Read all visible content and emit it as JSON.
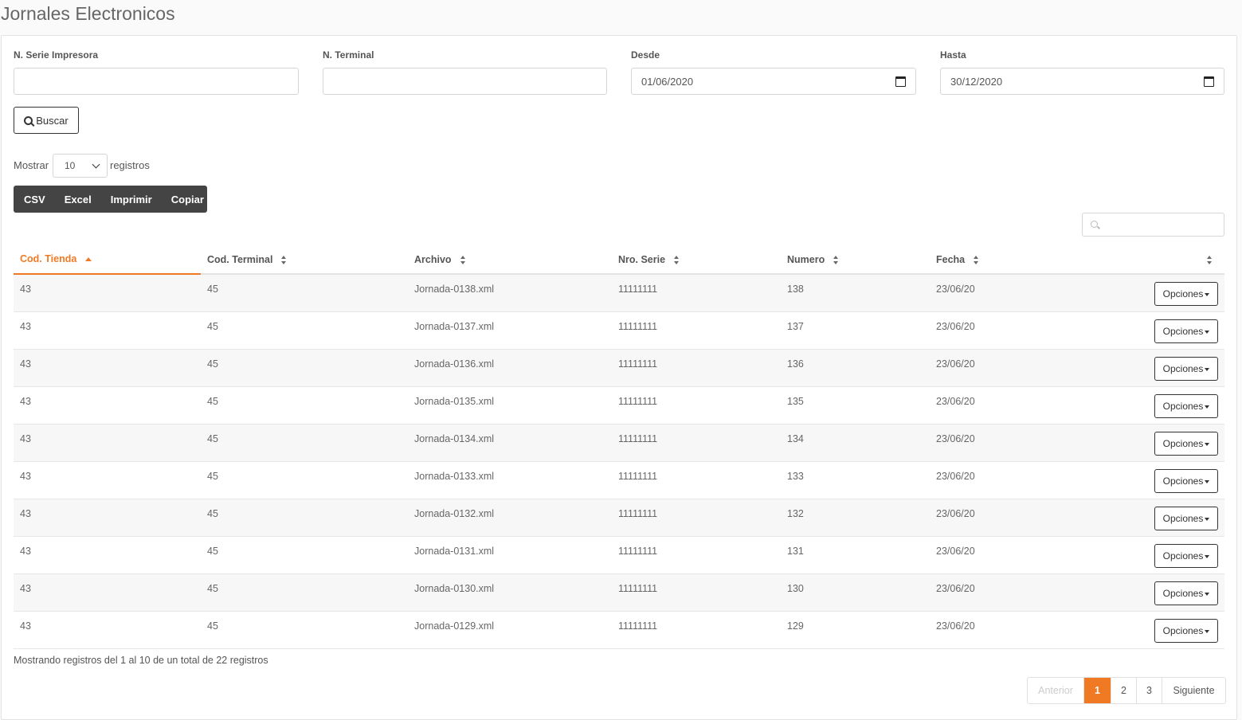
{
  "page_title": "Jornales Electronicos",
  "filters": {
    "serie_label": "N. Serie Impresora",
    "serie_value": "",
    "terminal_label": "N. Terminal",
    "terminal_value": "",
    "desde_label": "Desde",
    "desde_value": "01/06/2020",
    "hasta_label": "Hasta",
    "hasta_value": "30/12/2020",
    "search_button": "Buscar"
  },
  "length_menu": {
    "prefix": "Mostrar",
    "value": "10",
    "suffix": "registros"
  },
  "export_buttons": [
    "CSV",
    "Excel",
    "Imprimir",
    "Copiar"
  ],
  "table_search": {
    "value": ""
  },
  "table": {
    "columns": [
      "Cod. Tienda",
      "Cod. Terminal",
      "Archivo",
      "Nro. Serie",
      "Numero",
      "Fecha",
      ""
    ],
    "sorted_column": "Cod. Tienda",
    "sort_direction": "asc",
    "rows": [
      [
        "43",
        "45",
        "Jornada-0138.xml",
        "11111111",
        "138",
        "23/06/20",
        "Opciones"
      ],
      [
        "43",
        "45",
        "Jornada-0137.xml",
        "11111111",
        "137",
        "23/06/20",
        "Opciones"
      ],
      [
        "43",
        "45",
        "Jornada-0136.xml",
        "11111111",
        "136",
        "23/06/20",
        "Opciones"
      ],
      [
        "43",
        "45",
        "Jornada-0135.xml",
        "11111111",
        "135",
        "23/06/20",
        "Opciones"
      ],
      [
        "43",
        "45",
        "Jornada-0134.xml",
        "11111111",
        "134",
        "23/06/20",
        "Opciones"
      ],
      [
        "43",
        "45",
        "Jornada-0133.xml",
        "11111111",
        "133",
        "23/06/20",
        "Opciones"
      ],
      [
        "43",
        "45",
        "Jornada-0132.xml",
        "11111111",
        "132",
        "23/06/20",
        "Opciones"
      ],
      [
        "43",
        "45",
        "Jornada-0131.xml",
        "11111111",
        "131",
        "23/06/20",
        "Opciones"
      ],
      [
        "43",
        "45",
        "Jornada-0130.xml",
        "11111111",
        "130",
        "23/06/20",
        "Opciones"
      ],
      [
        "43",
        "45",
        "Jornada-0129.xml",
        "11111111",
        "129",
        "23/06/20",
        "Opciones"
      ]
    ]
  },
  "info_text": "Mostrando registros del 1 al 10 de un total de 22 registros",
  "pagination": {
    "previous": "Anterior",
    "pages": [
      "1",
      "2",
      "3"
    ],
    "current": "1",
    "next": "Siguiente"
  },
  "colors": {
    "accent": "#f07a24",
    "dark_button": "#444444"
  }
}
